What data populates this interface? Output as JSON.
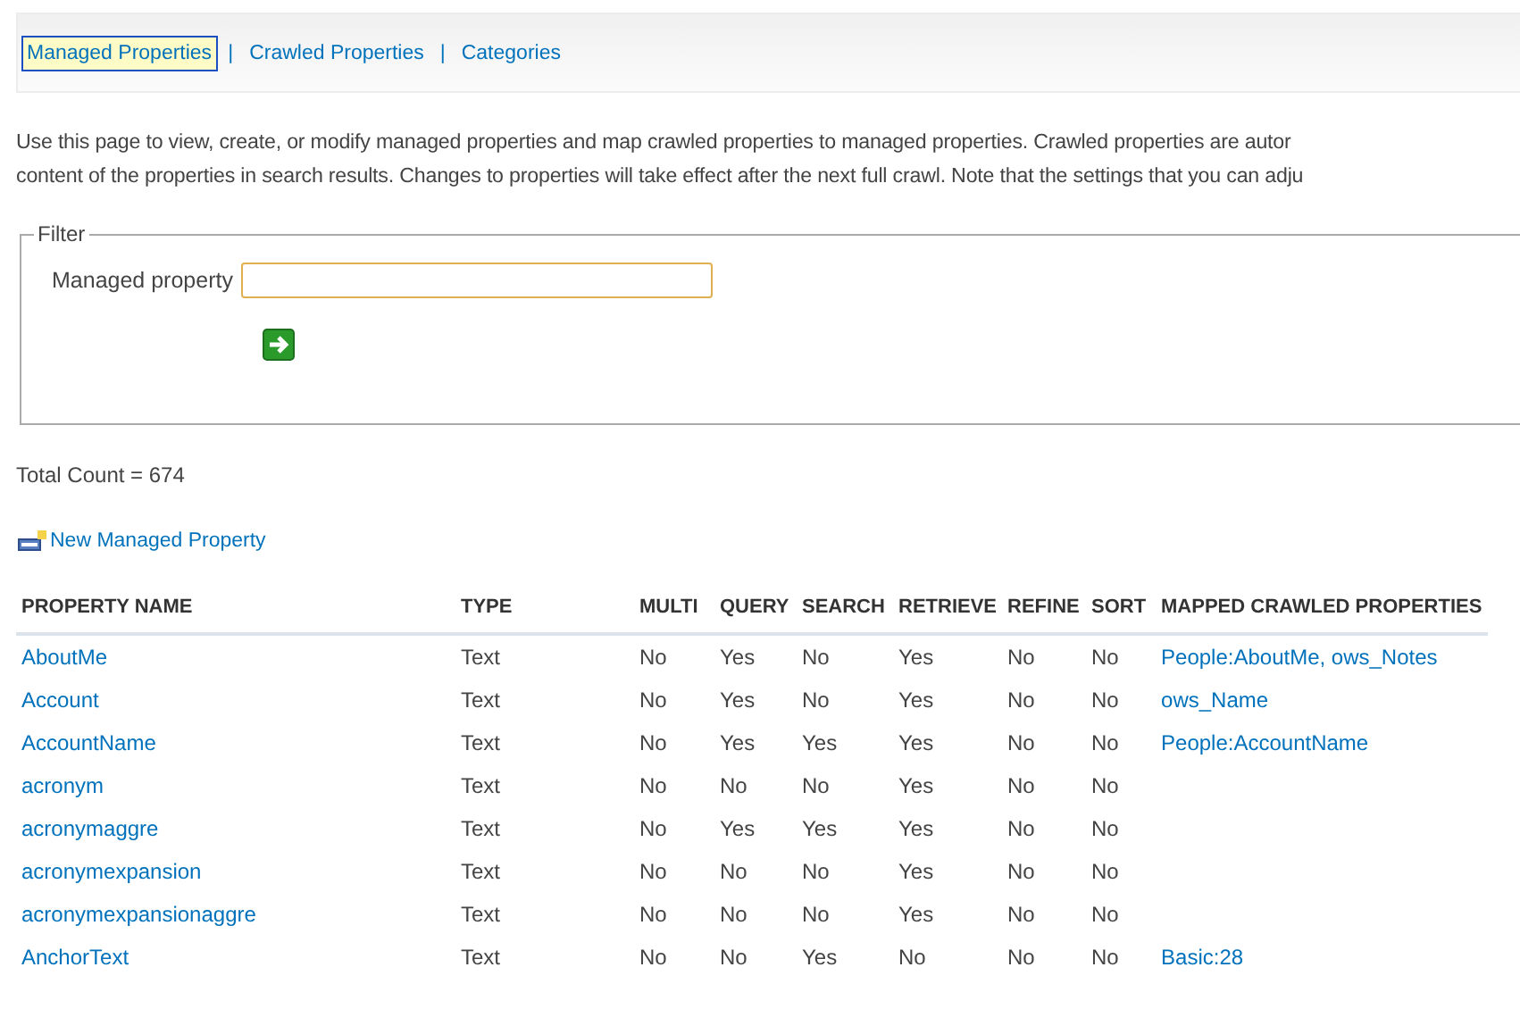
{
  "tabs": [
    {
      "label": "Managed Properties",
      "selected": true
    },
    {
      "label": "Crawled Properties",
      "selected": false
    },
    {
      "label": "Categories",
      "selected": false
    }
  ],
  "tab_separator": "|",
  "description": [
    "Use this page to view, create, or modify managed properties and map crawled properties to managed properties. Crawled properties are autor",
    "content of the properties in search results. Changes to properties will take effect after the next full crawl. Note that the settings that you can adju"
  ],
  "filter": {
    "legend": "Filter",
    "label": "Managed property"
  },
  "total_count": "Total Count = 674",
  "new_link": "New Managed Property",
  "table": {
    "columns": [
      "PROPERTY NAME",
      "TYPE",
      "MULTI",
      "QUERY",
      "SEARCH",
      "RETRIEVE",
      "REFINE",
      "SORT",
      "MAPPED CRAWLED PROPERTIES"
    ],
    "rows": [
      [
        "AboutMe",
        "Text",
        "No",
        "Yes",
        "No",
        "Yes",
        "No",
        "No",
        "People:AboutMe, ows_Notes"
      ],
      [
        "Account",
        "Text",
        "No",
        "Yes",
        "No",
        "Yes",
        "No",
        "No",
        "ows_Name"
      ],
      [
        "AccountName",
        "Text",
        "No",
        "Yes",
        "Yes",
        "Yes",
        "No",
        "No",
        "People:AccountName"
      ],
      [
        "acronym",
        "Text",
        "No",
        "No",
        "No",
        "Yes",
        "No",
        "No",
        ""
      ],
      [
        "acronymaggre",
        "Text",
        "No",
        "Yes",
        "Yes",
        "Yes",
        "No",
        "No",
        ""
      ],
      [
        "acronymexpansion",
        "Text",
        "No",
        "No",
        "No",
        "Yes",
        "No",
        "No",
        ""
      ],
      [
        "acronymexpansionaggre",
        "Text",
        "No",
        "No",
        "No",
        "Yes",
        "No",
        "No",
        ""
      ],
      [
        "AnchorText",
        "Text",
        "No",
        "No",
        "Yes",
        "No",
        "No",
        "No",
        "Basic:28"
      ]
    ]
  }
}
